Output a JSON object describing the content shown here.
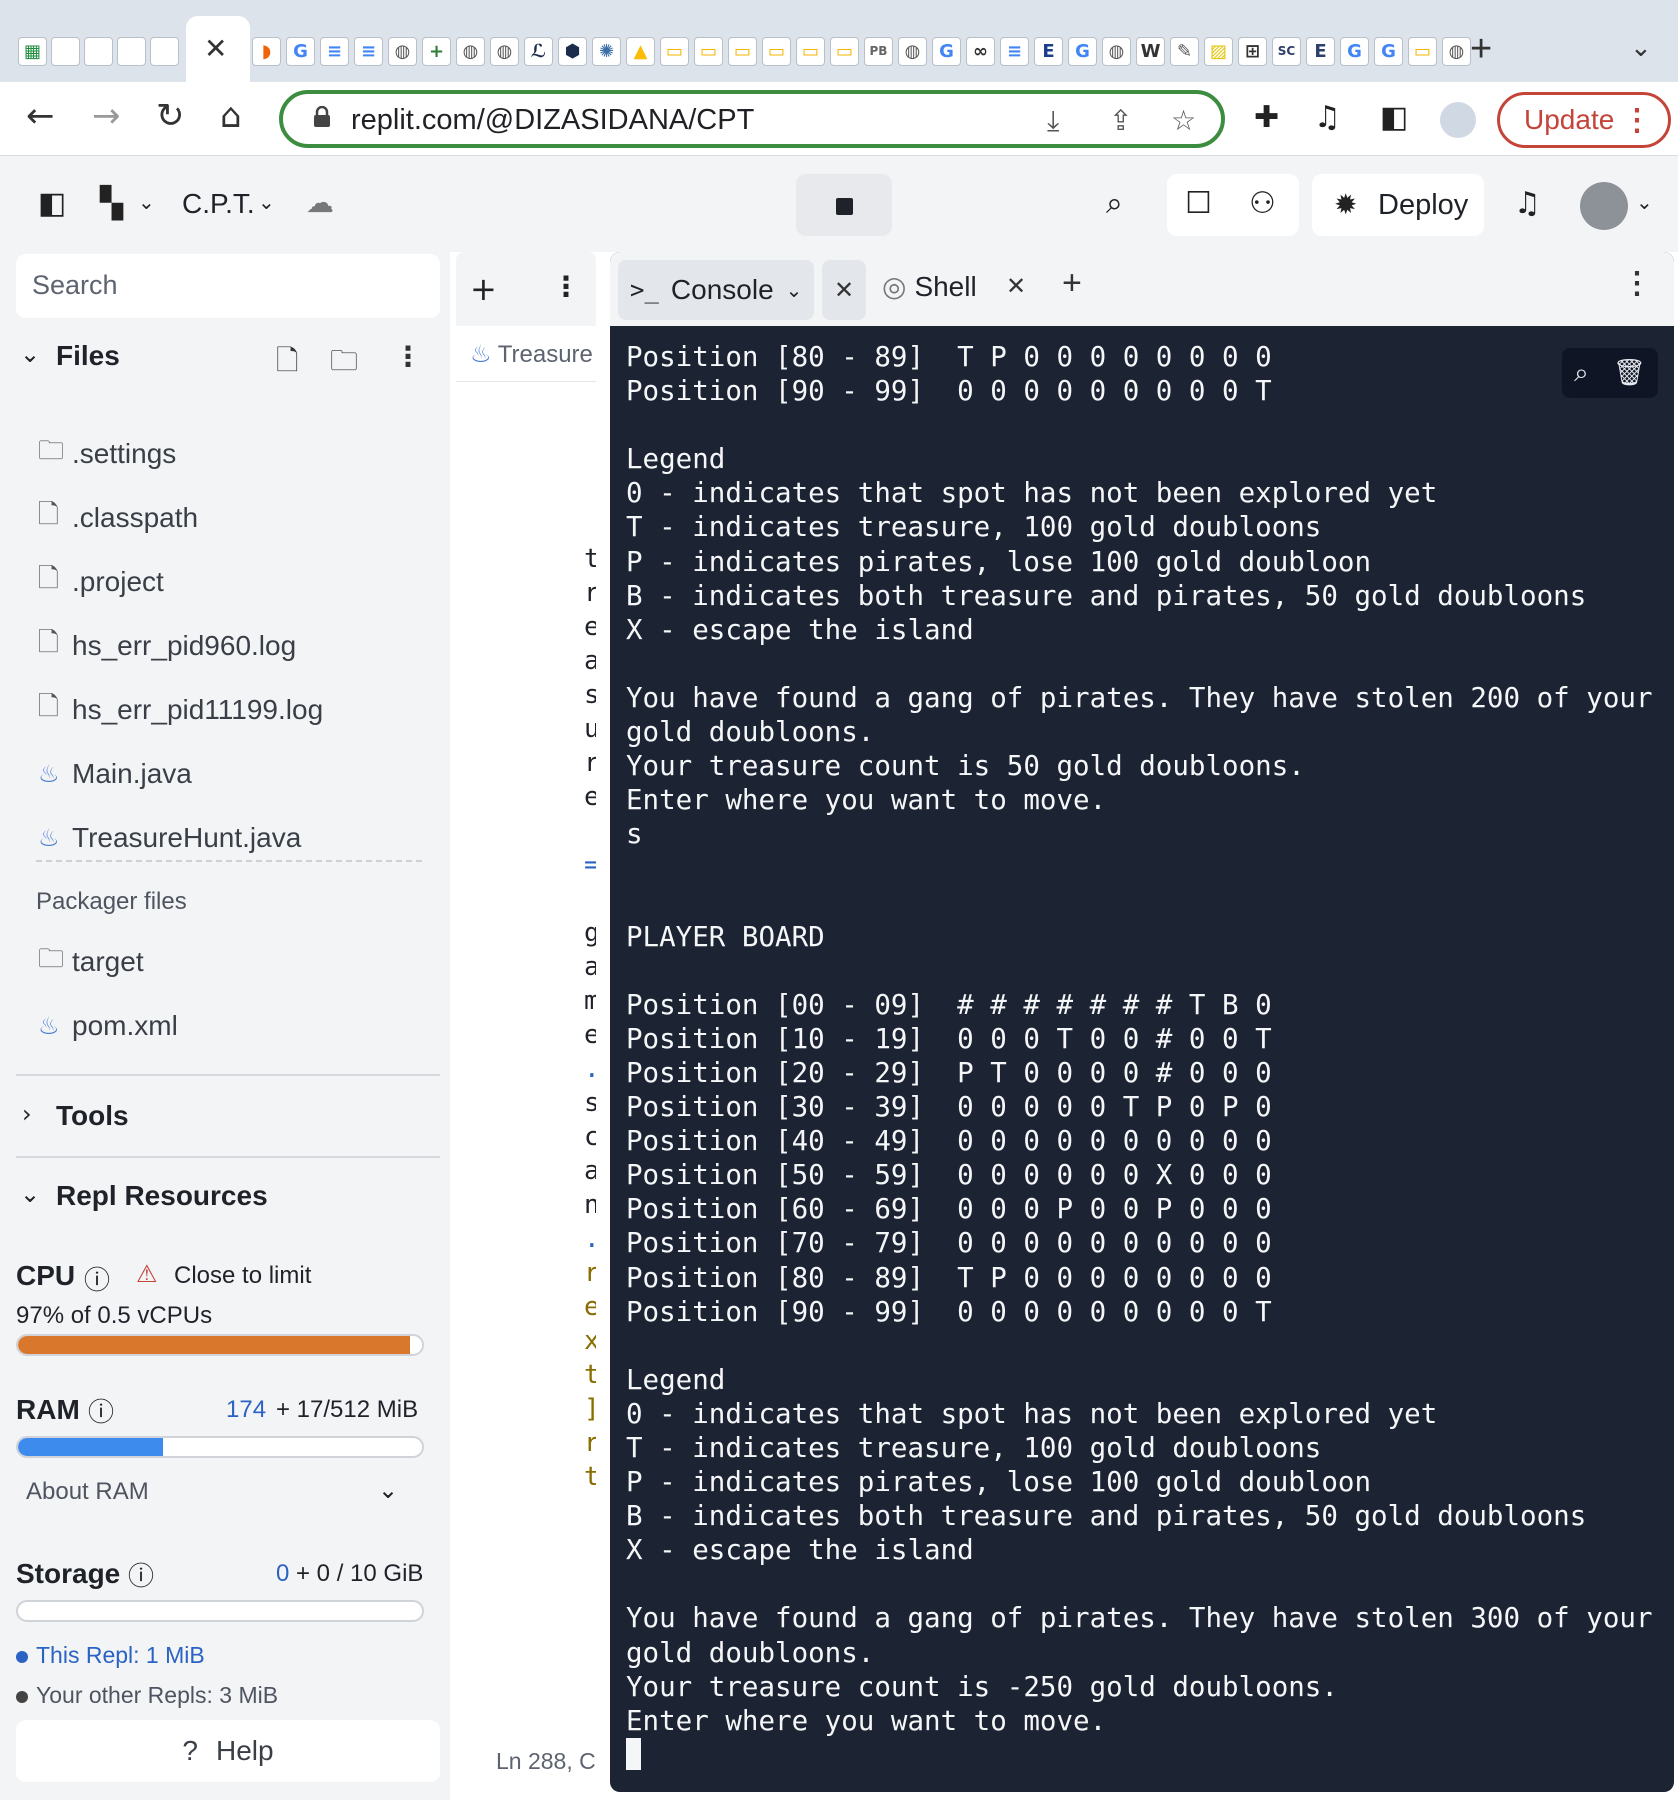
{
  "browser": {
    "favicon_tabs": [
      {
        "icon": "sheets-icon",
        "glyph": "▦",
        "color": "#1e8e3e"
      },
      {
        "icon": "code-icon",
        "glyph": "[·]",
        "color": "#ffffff"
      },
      {
        "icon": "notion-icon",
        "glyph": "N",
        "color": "#ffffff"
      },
      {
        "icon": "notion-icon",
        "glyph": "N",
        "color": "#ffffff"
      },
      {
        "icon": "notion-icon",
        "glyph": "N",
        "color": "#ffffff"
      }
    ],
    "favicon_tabs_right": [
      {
        "icon": "replit-icon",
        "glyph": "◗",
        "color": "#f26207"
      },
      {
        "icon": "google-icon",
        "glyph": "G",
        "color": "#4285f4"
      },
      {
        "icon": "docs-icon",
        "glyph": "≡",
        "color": "#4285f4"
      },
      {
        "icon": "docs-icon",
        "glyph": "≡",
        "color": "#4285f4"
      },
      {
        "icon": "globe-icon",
        "glyph": "◍",
        "color": "#555555"
      },
      {
        "icon": "cross-icon",
        "glyph": "+",
        "color": "#2e7d32"
      },
      {
        "icon": "globe-icon",
        "glyph": "◍",
        "color": "#555555"
      },
      {
        "icon": "globe-icon",
        "glyph": "◍",
        "color": "#555555"
      },
      {
        "icon": "pen-icon",
        "glyph": "ℒ",
        "color": "#1a2b4c"
      },
      {
        "icon": "shield-icon",
        "glyph": "⬢",
        "color": "#1a2b4c"
      },
      {
        "icon": "seal-icon",
        "glyph": "✺",
        "color": "#3b6ea5"
      },
      {
        "icon": "drive-icon",
        "glyph": "▲",
        "color": "#fbbc04"
      },
      {
        "icon": "slides-icon",
        "glyph": "▭",
        "color": "#f4b400"
      },
      {
        "icon": "slides-icon",
        "glyph": "▭",
        "color": "#f4b400"
      },
      {
        "icon": "slides-icon",
        "glyph": "▭",
        "color": "#f4b400"
      },
      {
        "icon": "slides-icon",
        "glyph": "▭",
        "color": "#f4b400"
      },
      {
        "icon": "slides-icon",
        "glyph": "▭",
        "color": "#f4b400"
      },
      {
        "icon": "slides-icon",
        "glyph": "▭",
        "color": "#f4b400"
      },
      {
        "icon": "pb-icon",
        "glyph": "PB",
        "color": "#666666"
      },
      {
        "icon": "globe-icon",
        "glyph": "◍",
        "color": "#555555"
      },
      {
        "icon": "google-icon",
        "glyph": "G",
        "color": "#4285f4"
      },
      {
        "icon": "link-icon",
        "glyph": "∞",
        "color": "#333333"
      },
      {
        "icon": "docs-icon",
        "glyph": "≡",
        "color": "#4285f4"
      },
      {
        "icon": "e-icon",
        "glyph": "E",
        "color": "#1a3e8c"
      },
      {
        "icon": "google-icon",
        "glyph": "G",
        "color": "#4285f4"
      },
      {
        "icon": "globe-icon",
        "glyph": "◍",
        "color": "#555555"
      },
      {
        "icon": "w-icon",
        "glyph": "W",
        "color": "#333333"
      },
      {
        "icon": "feather-icon",
        "glyph": "✎",
        "color": "#555555"
      },
      {
        "icon": "hazard-icon",
        "glyph": "▨",
        "color": "#e6c200"
      },
      {
        "icon": "grid-icon",
        "glyph": "⊞",
        "color": "#333333"
      },
      {
        "icon": "sc-icon",
        "glyph": "SC",
        "color": "#2c3e6b"
      },
      {
        "icon": "e-icon",
        "glyph": "E",
        "color": "#2c3e6b"
      },
      {
        "icon": "google-icon",
        "glyph": "G",
        "color": "#4285f4"
      },
      {
        "icon": "google-icon",
        "glyph": "G",
        "color": "#4285f4"
      },
      {
        "icon": "slides-icon",
        "glyph": "▭",
        "color": "#f4b400"
      },
      {
        "icon": "globe-icon",
        "glyph": "◍",
        "color": "#555555"
      }
    ],
    "active_tab_close": "✕",
    "new_tab": "+",
    "tab_menu": "⌄",
    "url": "replit.com/@DIZASIDANA/CPT",
    "update_label": "Update",
    "accent_green": "#3c8d40",
    "update_color": "#c5443a"
  },
  "replit": {
    "project_name": "C.P.T.",
    "deploy_label": "Deploy"
  },
  "sidebar": {
    "search_placeholder": "Search",
    "files_title": "Files",
    "files": [
      {
        "name": ".settings",
        "kind": "folder"
      },
      {
        "name": ".classpath",
        "kind": "file"
      },
      {
        "name": ".project",
        "kind": "file"
      },
      {
        "name": "hs_err_pid960.log",
        "kind": "file"
      },
      {
        "name": "hs_err_pid11199.log",
        "kind": "file"
      },
      {
        "name": "Main.java",
        "kind": "java"
      },
      {
        "name": "TreasureHunt.java",
        "kind": "java"
      }
    ],
    "packager_title": "Packager files",
    "packager_files": [
      {
        "name": "target",
        "kind": "folder"
      },
      {
        "name": "pom.xml",
        "kind": "java"
      }
    ],
    "tools_title": "Tools",
    "resources_title": "Repl Resources",
    "cpu": {
      "label": "CPU",
      "warning": "Close to limit",
      "usage_text": "97% of 0.5 vCPUs",
      "usage_fraction": 0.97,
      "color": "#d9782d"
    },
    "ram": {
      "label": "RAM",
      "used": "174",
      "rest": "+ 17/512 MiB",
      "usage_fraction": 0.36,
      "color": "#3d8bec"
    },
    "about_ram": "About RAM",
    "storage": {
      "label": "Storage",
      "used": "0",
      "rest": "+ 0 / 10 GiB"
    },
    "storage_legend": [
      {
        "label": "This Repl: 1 MiB",
        "color": "#2b62c4"
      },
      {
        "label": "Your other Repls: 3 MiB",
        "color": "#444444"
      }
    ],
    "help_label": "Help"
  },
  "editor": {
    "tab_label": "Treasure",
    "status": "Ln 288, C",
    "visible_chars": [
      {
        "c": "t",
        "color": "#1f2329"
      },
      {
        "c": "r",
        "color": "#1f2329"
      },
      {
        "c": "e",
        "color": "#1f2329"
      },
      {
        "c": "a",
        "color": "#1f2329"
      },
      {
        "c": "s",
        "color": "#1f2329"
      },
      {
        "c": "u",
        "color": "#1f2329"
      },
      {
        "c": "r",
        "color": "#1f2329"
      },
      {
        "c": "e",
        "color": "#1f2329"
      },
      {
        "c": "",
        "color": "#1f2329"
      },
      {
        "c": "=",
        "color": "#2b62c4"
      },
      {
        "c": "",
        "color": "#1f2329"
      },
      {
        "c": "g",
        "color": "#1f2329"
      },
      {
        "c": "a",
        "color": "#1f2329"
      },
      {
        "c": "m",
        "color": "#1f2329"
      },
      {
        "c": "e",
        "color": "#1f2329"
      },
      {
        "c": ".",
        "color": "#2b62c4"
      },
      {
        "c": "s",
        "color": "#1f2329"
      },
      {
        "c": "c",
        "color": "#1f2329"
      },
      {
        "c": "a",
        "color": "#1f2329"
      },
      {
        "c": "n",
        "color": "#1f2329"
      },
      {
        "c": ".",
        "color": "#2b62c4"
      },
      {
        "c": "r",
        "color": "#8a6d00"
      },
      {
        "c": "e",
        "color": "#8a6d00"
      },
      {
        "c": "x",
        "color": "#8a6d00"
      },
      {
        "c": "t",
        "color": "#8a6d00"
      },
      {
        "c": "]",
        "color": "#8a6d00"
      },
      {
        "c": "r",
        "color": "#8a6d00"
      },
      {
        "c": "t",
        "color": "#8a6d00"
      }
    ]
  },
  "console": {
    "console_tab": "Console",
    "shell_tab": "Shell",
    "lines": [
      "Position [80 - 89]  T P 0 0 0 0 0 0 0 0",
      "Position [90 - 99]  0 0 0 0 0 0 0 0 0 T",
      "",
      "Legend",
      "0 - indicates that spot has not been explored yet",
      "T - indicates treasure, 100 gold doubloons",
      "P - indicates pirates, lose 100 gold doubloon",
      "B - indicates both treasure and pirates, 50 gold doubloons",
      "X - escape the island",
      "",
      "You have found a gang of pirates. They have stolen 200 of your",
      "gold doubloons.",
      "Your treasure count is 50 gold doubloons.",
      "Enter where you want to move.",
      "s",
      "",
      "",
      "PLAYER BOARD",
      "",
      "Position [00 - 09]  # # # # # # # T B 0",
      "Position [10 - 19]  0 0 0 T 0 0 # 0 0 T",
      "Position [20 - 29]  P T 0 0 0 0 # 0 0 0",
      "Position [30 - 39]  0 0 0 0 0 T P 0 P 0",
      "Position [40 - 49]  0 0 0 0 0 0 0 0 0 0",
      "Position [50 - 59]  0 0 0 0 0 0 X 0 0 0",
      "Position [60 - 69]  0 0 0 P 0 0 P 0 0 0",
      "Position [70 - 79]  0 0 0 0 0 0 0 0 0 0",
      "Position [80 - 89]  T P 0 0 0 0 0 0 0 0",
      "Position [90 - 99]  0 0 0 0 0 0 0 0 0 T",
      "",
      "Legend",
      "0 - indicates that spot has not been explored yet",
      "T - indicates treasure, 100 gold doubloons",
      "P - indicates pirates, lose 100 gold doubloon",
      "B - indicates both treasure and pirates, 50 gold doubloons",
      "X - escape the island",
      "",
      "You have found a gang of pirates. They have stolen 300 of your",
      "gold doubloons.",
      "Your treasure count is -250 gold doubloons.",
      "Enter where you want to move."
    ],
    "background": "#1c2333"
  }
}
